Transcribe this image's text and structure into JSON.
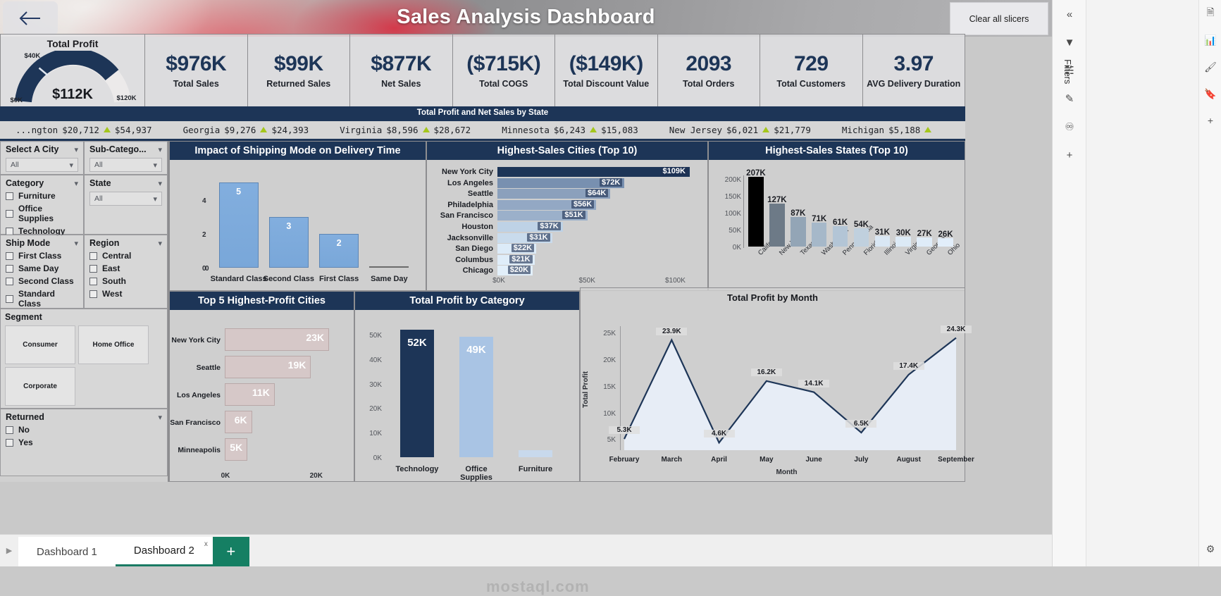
{
  "header": {
    "title": "Sales Analysis Dashboard",
    "back_icon": "back-arrow-icon",
    "clear_slicers_label": "Clear all slicers"
  },
  "gauge": {
    "title": "Total Profit",
    "value": "$112K",
    "min": "$0K",
    "max": "$120K",
    "target": "$40K",
    "value_number": 112,
    "min_number": 0,
    "max_number": 120,
    "target_number": 40
  },
  "kpis": [
    {
      "value": "$976K",
      "label": "Total Sales"
    },
    {
      "value": "$99K",
      "label": "Returned Sales"
    },
    {
      "value": "$877K",
      "label": "Net Sales"
    },
    {
      "value": "($715K)",
      "label": "Total COGS"
    },
    {
      "value": "($149K)",
      "label": "Total Discount Value"
    },
    {
      "value": "2093",
      "label": "Total Orders"
    },
    {
      "value": "729",
      "label": "Total Customers"
    },
    {
      "value": "3.97",
      "label": "AVG Delivery Duration"
    }
  ],
  "ticker": {
    "title": "Total Profit and Net Sales by State",
    "items": [
      {
        "state": "...ngton",
        "profit": "$20,712",
        "net": "$54,937"
      },
      {
        "state": "Georgia",
        "profit": "$9,276",
        "net": "$24,393"
      },
      {
        "state": "Virginia",
        "profit": "$8,596",
        "net": "$28,672"
      },
      {
        "state": "Minnesota",
        "profit": "$6,243",
        "net": "$15,083"
      },
      {
        "state": "New Jersey",
        "profit": "$6,021",
        "net": "$21,779"
      },
      {
        "state": "Michigan",
        "profit": "$5,188",
        "net": ""
      }
    ]
  },
  "slicers": {
    "select_city": {
      "title": "Select A City",
      "value": "All"
    },
    "sub_category": {
      "title": "Sub-Catego...",
      "value": "All"
    },
    "category": {
      "title": "Category",
      "options": [
        "Furniture",
        "Office Supplies",
        "Technology"
      ]
    },
    "state": {
      "title": "State",
      "value": "All"
    },
    "ship_mode": {
      "title": "Ship Mode",
      "options": [
        "First Class",
        "Same Day",
        "Second Class",
        "Standard Class"
      ]
    },
    "region": {
      "title": "Region",
      "options": [
        "Central",
        "East",
        "South",
        "West"
      ]
    },
    "segment": {
      "title": "Segment",
      "options": [
        "Consumer",
        "Home Office",
        "Corporate"
      ]
    },
    "returned": {
      "title": "Returned",
      "options": [
        "No",
        "Yes"
      ]
    }
  },
  "panels": {
    "shipping": "Impact of Shipping Mode on Delivery Time",
    "cities": "Highest-Sales Cities (Top 10)",
    "states": "Highest-Sales States (Top 10)",
    "profit_cities": "Top 5 Highest-Profit Cities",
    "profit_category": "Total Profit by Category",
    "profit_month": "Total Profit by Month"
  },
  "tabs": {
    "items": [
      {
        "label": "Dashboard 1",
        "active": false
      },
      {
        "label": "Dashboard 2",
        "active": true
      }
    ],
    "close_label": "x",
    "add_label": "+"
  },
  "right_rail": {
    "collapse_icon": "chevron-double-left-icon",
    "filters_label": "Filters",
    "icons": [
      "filter-icon",
      "fields-icon",
      "format-icon",
      "bookmark-icon",
      "add-icon"
    ]
  },
  "far_rail": {
    "icons": [
      "copy-icon",
      "chart-icon",
      "paint-icon",
      "bookmark-icon",
      "plus-icon",
      "settings-icon"
    ]
  },
  "watermark": "mostaql.com",
  "colors": {
    "navy": "#1d3557",
    "accent_green": "#a4c61c",
    "tab_green": "#157f63",
    "bar_blue": "#79a7d9"
  },
  "chart_data": [
    {
      "type": "bar",
      "title": "Impact of Shipping Mode on Delivery Time",
      "categories": [
        "Standard Class",
        "Second Class",
        "First Class",
        "Same Day"
      ],
      "values": [
        5,
        3,
        2,
        0
      ],
      "value_labels": [
        "5",
        "3",
        "2",
        ""
      ],
      "yticks": [
        "0",
        "2",
        "4"
      ],
      "ytick_values": [
        0,
        2,
        4
      ],
      "ylim": [
        0,
        5.6
      ],
      "xlabel": "",
      "ylabel": "",
      "grid": false
    },
    {
      "type": "bar",
      "orientation": "horizontal",
      "title": "Highest-Sales Cities (Top 10)",
      "categories": [
        "New York City",
        "Los Angeles",
        "Seattle",
        "Philadelphia",
        "San Francisco",
        "Houston",
        "Jacksonville",
        "San Diego",
        "Columbus",
        "Chicago"
      ],
      "values": [
        109,
        72,
        64,
        56,
        51,
        37,
        31,
        22,
        21,
        20
      ],
      "value_labels": [
        "$109K",
        "$72K",
        "$64K",
        "$56K",
        "$51K",
        "$37K",
        "$31K",
        "$22K",
        "$21K",
        "$20K"
      ],
      "xticks": [
        "$0K",
        "$50K",
        "$100K"
      ],
      "xtick_values": [
        0,
        50,
        100
      ],
      "xlim": [
        0,
        115
      ],
      "xlabel": "",
      "ylabel": "",
      "grid": false
    },
    {
      "type": "bar",
      "title": "Highest-Sales States (Top 10)",
      "categories": [
        "California",
        "New York",
        "Texas",
        "Washington",
        "Pennsylvania",
        "Florida",
        "Illinois",
        "Virginia",
        "Georgia",
        "Ohio"
      ],
      "values": [
        207,
        127,
        87,
        71,
        61,
        54,
        31,
        30,
        27,
        26
      ],
      "value_labels": [
        "207K",
        "127K",
        "87K",
        "71K",
        "61K",
        "54K",
        "31K",
        "30K",
        "27K",
        "26K"
      ],
      "yticks": [
        "0K",
        "50K",
        "100K",
        "150K",
        "200K"
      ],
      "ytick_values": [
        0,
        50,
        100,
        150,
        200
      ],
      "ylim": [
        0,
        215
      ],
      "xlabel": "",
      "ylabel": "",
      "grid": false
    },
    {
      "type": "bar",
      "orientation": "horizontal",
      "title": "Top 5 Highest-Profit Cities",
      "categories": [
        "New York City",
        "Seattle",
        "Los Angeles",
        "San Francisco",
        "Minneapolis"
      ],
      "values": [
        23,
        19,
        11,
        6,
        5
      ],
      "value_labels": [
        "23K",
        "19K",
        "11K",
        "6K",
        "5K"
      ],
      "xticks": [
        "0K",
        "20K"
      ],
      "xtick_values": [
        0,
        20
      ],
      "xlim": [
        0,
        25
      ],
      "xlabel": "",
      "ylabel": "",
      "grid": false
    },
    {
      "type": "bar",
      "title": "Total Profit by Category",
      "categories": [
        "Technology",
        "Office Supplies",
        "Furniture"
      ],
      "values": [
        52,
        49,
        3
      ],
      "value_labels": [
        "52K",
        "49K",
        ""
      ],
      "yticks": [
        "0K",
        "10K",
        "20K",
        "30K",
        "40K",
        "50K"
      ],
      "ytick_values": [
        0,
        10,
        20,
        30,
        40,
        50
      ],
      "ylim": [
        0,
        56
      ],
      "xlabel": "",
      "ylabel": "",
      "grid": false
    },
    {
      "type": "line",
      "title": "Total Profit by Month",
      "categories": [
        "February",
        "March",
        "April",
        "May",
        "June",
        "July",
        "August",
        "September"
      ],
      "values": [
        5.3,
        23.9,
        4.6,
        16.2,
        14.1,
        6.5,
        17.4,
        24.3
      ],
      "value_labels": [
        "5.3K",
        "23.9K",
        "4.6K",
        "16.2K",
        "14.1K",
        "6.5K",
        "17.4K",
        "24.3K"
      ],
      "yticks": [
        "5K",
        "10K",
        "15K",
        "20K",
        "25K"
      ],
      "ytick_values": [
        5,
        10,
        15,
        20,
        25
      ],
      "ylim": [
        3.2,
        26.5
      ],
      "xlabel": "Month",
      "ylabel": "Total Profit",
      "grid": false,
      "area": true
    }
  ]
}
